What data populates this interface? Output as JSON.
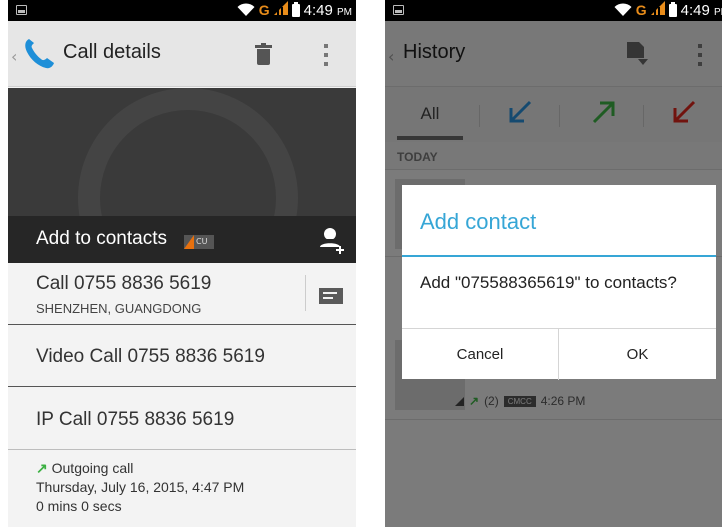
{
  "left_screen": {
    "status": {
      "time": "4:49",
      "ampm": "PM"
    },
    "action_bar": {
      "title": "Call details"
    },
    "add_to_contacts": {
      "label": "Add to contacts",
      "badge": "CU"
    },
    "rows": [
      {
        "main": "Call 0755 8836 5619",
        "sub": "SHENZHEN, GUANGDONG"
      },
      {
        "main": "Video Call 0755 8836 5619"
      },
      {
        "main": "IP Call 0755 8836 5619"
      }
    ],
    "call_info": {
      "type": "Outgoing call",
      "datetime": "Thursday, July 16, 2015, 4:47 PM",
      "duration": "0 mins 0 secs"
    }
  },
  "right_screen": {
    "status": {
      "time": "4:49",
      "ampm": "PM"
    },
    "action_bar": {
      "title": "History"
    },
    "tabs": {
      "all": "All",
      "icons": [
        "incoming-call-icon",
        "outgoing-call-icon",
        "missed-call-icon"
      ]
    },
    "section": "TODAY",
    "entry": {
      "count": "(2)",
      "carrier": "CMCC",
      "time": "4:26 PM"
    },
    "dialog": {
      "title": "Add contact",
      "message": "Add \"075588365619\" to contacts?",
      "cancel": "Cancel",
      "ok": "OK"
    }
  },
  "colors": {
    "accent_blue": "#36a6d6",
    "outgoing_green": "#3cb043",
    "missed_red": "#d9261c",
    "incoming_blue": "#2a8fd6",
    "carrier_orange": "#e88c1a"
  }
}
